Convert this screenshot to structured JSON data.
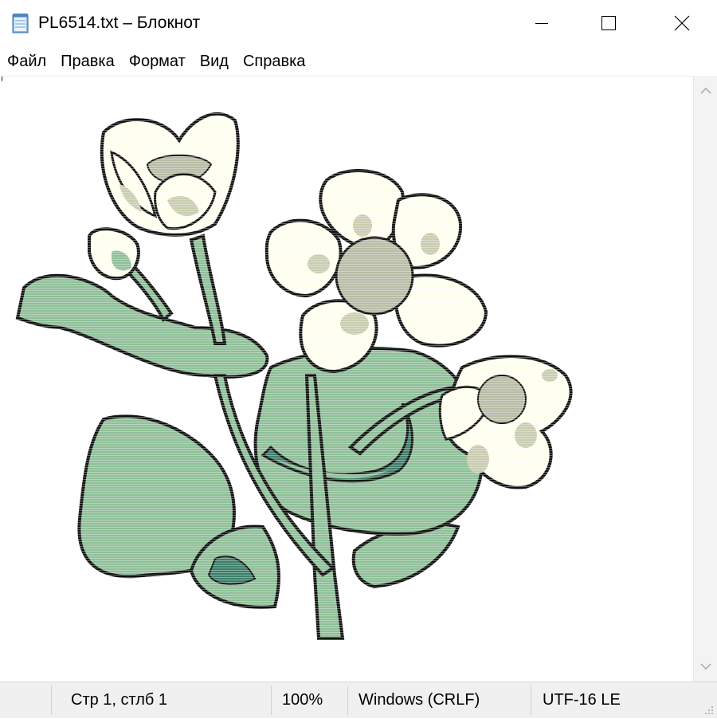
{
  "window": {
    "title": "PL6514.txt – Блокнот"
  },
  "menu": {
    "items": [
      "Файл",
      "Правка",
      "Формат",
      "Вид",
      "Справка"
    ]
  },
  "status": {
    "position": "Стр 1, стлб 1",
    "zoom": "100%",
    "line_ending": "Windows (CRLF)",
    "encoding": "UTF-16 LE"
  },
  "icons": {
    "app": "notepad-icon",
    "minimize": "minimize-icon",
    "maximize": "maximize-icon",
    "close": "close-icon",
    "scroll_up": "chevron-up-icon",
    "scroll_down": "chevron-down-icon",
    "grip": "resize-grip-icon"
  },
  "colors": {
    "leaf": "#8fbf98",
    "leaf_dark": "#3e7f6a",
    "petal": "#fffff0",
    "petal_shade": "#c9cdb0",
    "center": "#b9bca6",
    "outline": "#111111",
    "statusbar": "#f0f0f0"
  }
}
